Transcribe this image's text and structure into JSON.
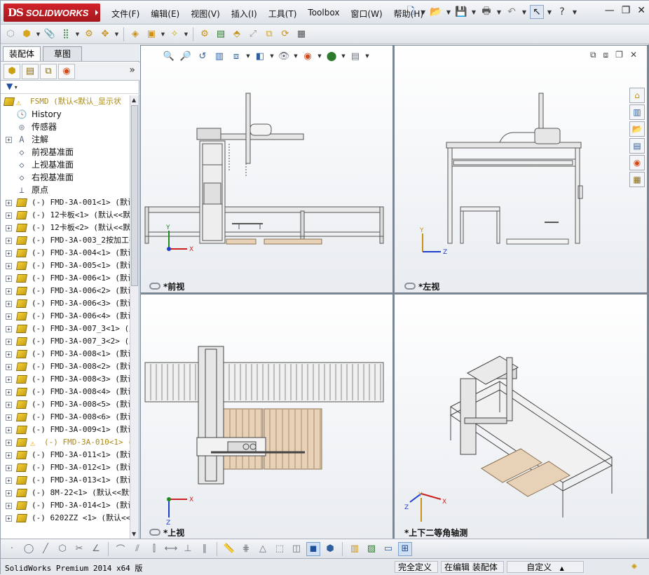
{
  "app": {
    "brand_ds": "DS",
    "brand_name": "SOLIDWORKS"
  },
  "menu": [
    "文件(F)",
    "编辑(E)",
    "视图(V)",
    "插入(I)",
    "工具(T)",
    "Toolbox",
    "窗口(W)",
    "帮助(H)"
  ],
  "left_panel": {
    "tabs": [
      "装配体",
      "草图"
    ],
    "more_label": "»",
    "tree": {
      "root": "FSMD  (默认<默认_显示状",
      "top_items": [
        "History",
        "传感器",
        "注解",
        "前视基准面",
        "上视基准面",
        "右视基准面",
        "原点"
      ],
      "components": [
        "(-) FMD-3A-001<1>  (默认",
        "(-) 12卡板<1>  (默认<<默",
        "(-) 12卡板<2>  (默认<<默",
        "(-) FMD-3A-003_2按加工<",
        "(-) FMD-3A-004<1>  (默认",
        "(-) FMD-3A-005<1>  (默认",
        "(-) FMD-3A-006<1>  (默认",
        "(-) FMD-3A-006<2>  (默认",
        "(-) FMD-3A-006<3>  (默认",
        "(-) FMD-3A-006<4>  (默认",
        "(-) FMD-3A-007_3<1>  (默",
        "(-) FMD-3A-007_3<2>  (默",
        "(-) FMD-3A-008<1>  (默认",
        "(-) FMD-3A-008<2>  (默认",
        "(-) FMD-3A-008<3>  (默认",
        "(-) FMD-3A-008<4>  (默认",
        "(-) FMD-3A-008<5>  (默认",
        "(-) FMD-3A-008<6>  (默认",
        "(-) FMD-3A-009<1>  (默认",
        "(-) FMD-3A-010<1>  (默",
        "(-) FMD-3A-011<1>  (默认",
        "(-) FMD-3A-012<1>  (默认",
        "(-) FMD-3A-013<1>  (默认",
        "(-) 8M-22<1>  (默认<<默认",
        "(-) FMD-3A-014<1>  (默认",
        "(-) 6202ZZ <1>  (默认<<默"
      ]
    }
  },
  "viewports": {
    "front": {
      "label": "*前视"
    },
    "left": {
      "label": "*左视"
    },
    "top": {
      "label": "*上视"
    },
    "iso": {
      "label": "*上下二等角轴测"
    }
  },
  "axes": {
    "x": "X",
    "y": "Y",
    "z": "Z"
  },
  "status": {
    "product": "SolidWorks Premium 2014 x64 版",
    "defined": "完全定义",
    "editing": "在编辑 装配体",
    "units": "自定义",
    "units_arrow": "▲"
  },
  "colors": {
    "brand_red": "#c41e25",
    "tree_warning": "#a8891a",
    "axis_x": "#cc1f1f",
    "axis_y": "#1f8a1f",
    "axis_z": "#1f3fcc",
    "pallet_wood": "#e8d2b7"
  }
}
